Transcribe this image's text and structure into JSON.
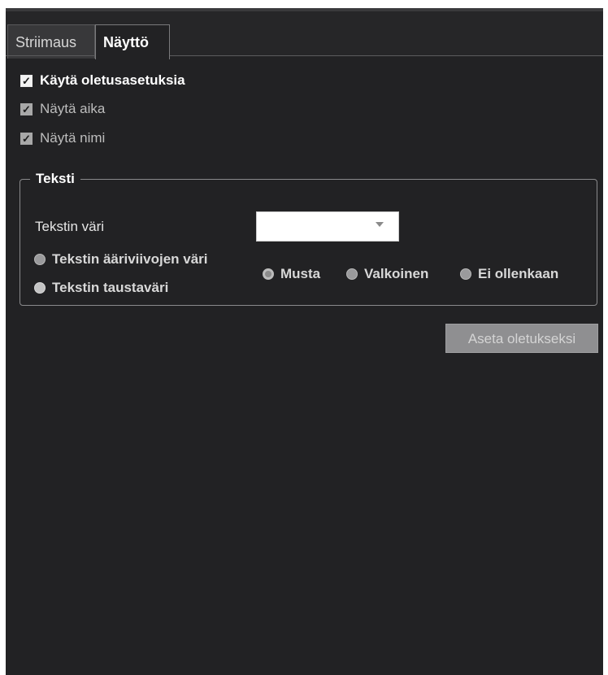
{
  "tabs": [
    {
      "label": "Striimaus",
      "active": false
    },
    {
      "label": "Näyttö",
      "active": true
    }
  ],
  "options": {
    "use_defaults": {
      "label": "Käytä oletusasetuksia",
      "checked": true
    },
    "show_time": {
      "label": "Näytä aika",
      "checked": true
    },
    "show_name": {
      "label": "Näytä nimi",
      "checked": true
    }
  },
  "text_group": {
    "legend": "Teksti",
    "text_color_label": "Tekstin väri",
    "text_color_value": "",
    "outline_color_label": "Tekstin ääriviivojen väri",
    "background_color_label": "Tekstin taustaväri",
    "color_choices": [
      "Musta",
      "Valkoinen",
      "Ei ollenkaan"
    ]
  },
  "buttons": {
    "set_default": "Aseta oletukseksi"
  },
  "colors": {
    "background": "#222224",
    "tab_active_text": "#ffffff",
    "button_bg": "#8f8f91"
  }
}
